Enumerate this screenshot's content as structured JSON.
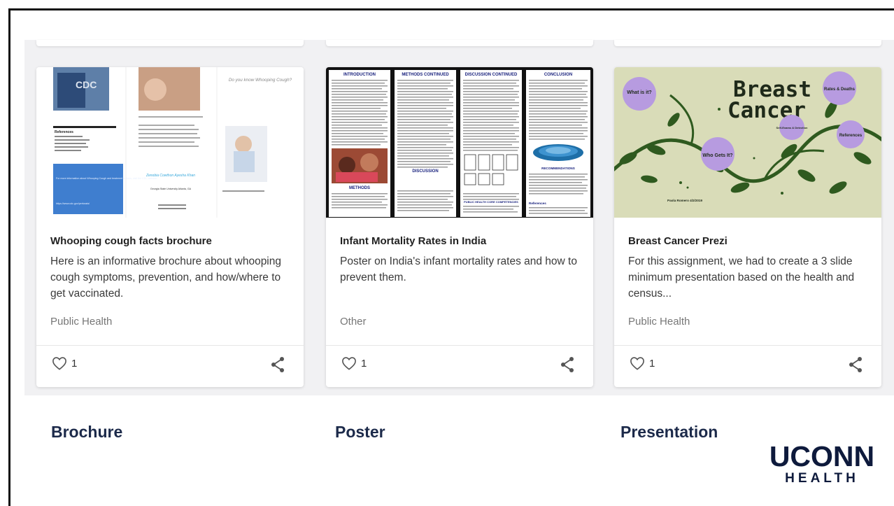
{
  "cards": [
    {
      "title": "Whooping cough facts brochure",
      "description": "Here is an informative brochure about whooping cough symptoms, prevention, and how/where to get vaccinated.",
      "category": "Public Health",
      "likes": "1",
      "thumbnail": {
        "question": "Do you know Whooping Cough?",
        "references_heading": "References",
        "authors": "Zenobia Cowthon Ayesha Khan",
        "school": "Georgia State University Atlanta, GA",
        "info_text": "For more information about Whooping Cough and treatment options, visit the CDC website:",
        "info_url": "https://www.cdc.gov/pertussis/"
      }
    },
    {
      "title": "Infant Mortality Rates in India",
      "description": "Poster on India's infant mortality rates and how to prevent them.",
      "category": "Other",
      "likes": "1",
      "thumbnail": {
        "panels": [
          "INTRODUCTION",
          "METHODS CONTINUED",
          "DISCUSSION CONTINUED",
          "CONCLUSION"
        ],
        "methods": "METHODS",
        "discussion": "DISCUSSION",
        "public_health": "PUBLIC HEALTH CORE COMPETENCIES",
        "recommendations": "RECOMMENDATIONS",
        "references": "References"
      }
    },
    {
      "title": "Breast Cancer Prezi",
      "description": "For this assignment, we had to create a 3 slide minimum presentation based on the health and census...",
      "category": "Public Health",
      "likes": "1",
      "thumbnail": {
        "title_line1": "Breast",
        "title_line2": "Cancer",
        "bubble_what": "What is it?",
        "bubble_rates": "Rates & Deaths",
        "bubble_self": "Self-Exams & Detection",
        "bubble_refs": "References",
        "bubble_who": "Who Gets It?",
        "author": "Paola Romero 4/2/2019"
      }
    }
  ],
  "captions": {
    "brochure": "Brochure",
    "poster": "Poster",
    "presentation": "Presentation"
  },
  "logo": {
    "main": "UCONN",
    "sub": "HEALTH"
  },
  "colors": {
    "caption": "#1c2a4a",
    "logo": "#0e1a3c",
    "prezi_bg": "#d9dcb8",
    "vine": "#2f5a1f",
    "bubble": "#b79be0"
  }
}
